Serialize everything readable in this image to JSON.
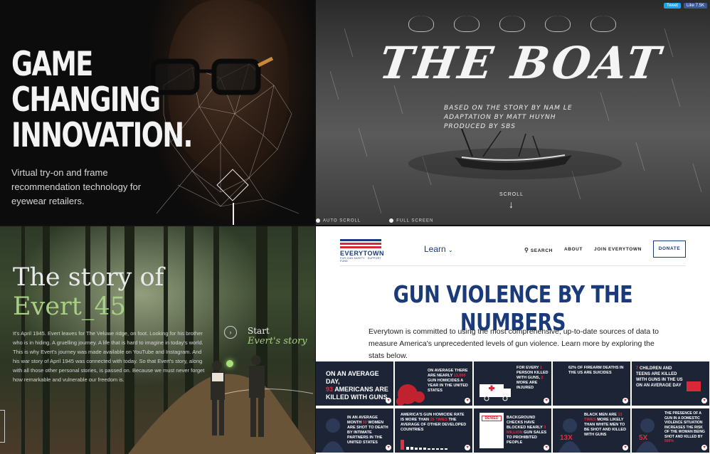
{
  "panel1": {
    "headline": [
      "GAME",
      "CHANGING",
      "INNOVATION."
    ],
    "description": "Virtual try-on and frame recommendation technology for eyewear retailers."
  },
  "panel2": {
    "share": {
      "tweet": "Tweet",
      "like": "Like 7.5K"
    },
    "title": "THE BOAT",
    "credits": [
      "BASED ON THE STORY BY NAM LE",
      "ADAPTATION BY MATT HUYNH",
      "PRODUCED BY SBS"
    ],
    "scroll_label": "SCROLL",
    "options": [
      "AUTO SCROLL",
      "FULL SCREEN"
    ]
  },
  "panel3": {
    "title_line1": "The story of",
    "title_line2": "Evert_45",
    "story": "It's April 1945. Evert leaves for The Veluwe ridge, on foot. Looking for his brother who is in hiding. A gruelling journey. A life that is hard to imagine in today's world. This is why Evert's journey was made available on YouTube and Instagram. And his war story of April 1945 was connected with today. So that Evert's story, along with all those other personal stories, is passed on. Because we must never forget how remarkable and vulnerable our freedom is.",
    "start_label": "Start",
    "start_sub": "Evert's story"
  },
  "panel4": {
    "logo": {
      "name": "EVERYTOWN",
      "sub": "FOR GUN SAFETY · SUPPORT FUND"
    },
    "learn": "Learn",
    "nav": [
      "SEARCH",
      "ABOUT",
      "JOIN EVERYTOWN"
    ],
    "donate": "DONATE",
    "heading": "GUN VIOLENCE BY THE NUMBERS",
    "intro": "Everytown is committed to using the most comprehensive, up-to-date sources of data to measure America's unprecedented levels of gun violence. Learn more by exploring the stats below.",
    "tiles_row1": [
      {
        "pre": "ON AN AVERAGE DAY,",
        "num": "93",
        "post": "AMERICANS ARE KILLED WITH GUNS"
      },
      {
        "pre": "ON AVERAGE THERE ARE NEARLY",
        "num": "13,000",
        "post": "GUN HOMICIDES A YEAR IN THE UNITED STATES"
      },
      {
        "pre": "FOR EVERY",
        "num": "1",
        "post": "PERSON KILLED WITH GUNS,",
        "num2": "2",
        "post2": "MORE ARE INJURED"
      },
      {
        "pre": "62% OF FIREARM DEATHS IN THE US ARE SUICIDES",
        "num": "",
        "post": ""
      },
      {
        "pre": "",
        "num": "7",
        "post": "CHILDREN AND TEENS ARE KILLED WITH GUNS IN THE US ON AN AVERAGE DAY"
      }
    ],
    "tiles_row2": [
      {
        "pre": "IN AN AVERAGE MONTH",
        "num": "50",
        "post": "WOMEN ARE SHOT TO DEATH BY INTIMATE PARTNERS IN THE UNITED STATES"
      },
      {
        "pre": "AMERICA'S GUN HOMICIDE RATE IS MORE THAN",
        "num": "25 TIMES",
        "post": "THE AVERAGE OF OTHER DEVELOPED COUNTRIES"
      },
      {
        "pre": "BACKGROUND CHECKS HAVE BLOCKED NEARLY",
        "num": "3 MILLION",
        "post": "GUN SALES TO PROHIBITED PEOPLE",
        "badge": "DENIED"
      },
      {
        "pre": "BLACK MEN ARE",
        "num": "13 TIMES",
        "post": "MORE LIKELY THAN WHITE MEN TO BE SHOT AND KILLED WITH GUNS",
        "big": "13X"
      },
      {
        "pre": "THE PRESENCE OF A GUN IN A DOMESTIC VIOLENCE SITUATION INCREASES THE RISK OF THE WOMAN BEING SHOT AND KILLED BY",
        "num": "500%",
        "post": "",
        "big": "5X"
      }
    ]
  }
}
